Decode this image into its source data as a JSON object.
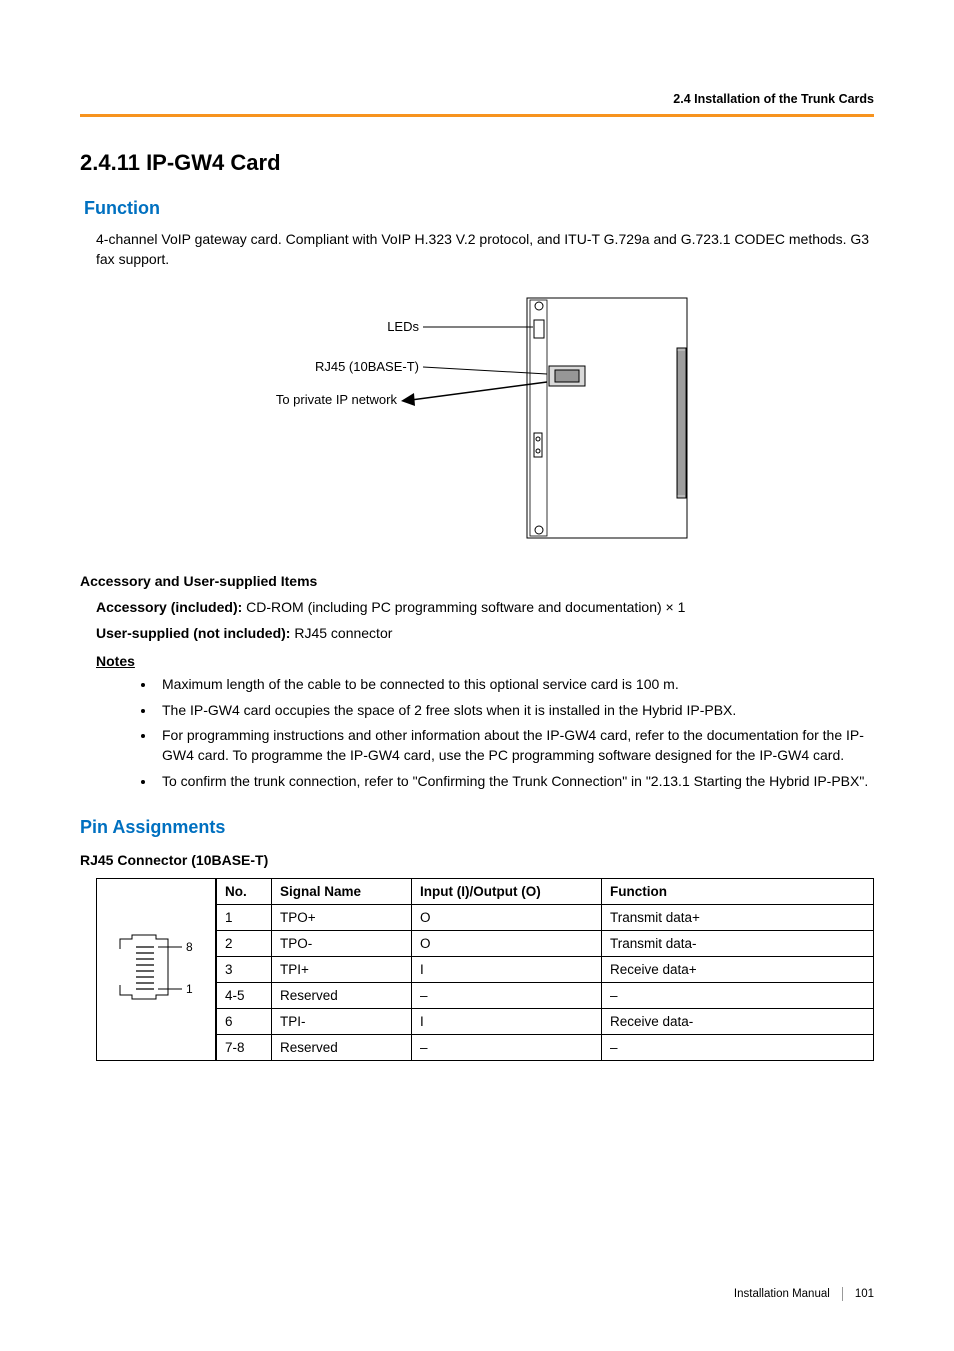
{
  "header": {
    "breadcrumb": "2.4 Installation of the Trunk Cards"
  },
  "title": "2.4.11  IP-GW4 Card",
  "function": {
    "heading": "Function",
    "body": "4-channel VoIP gateway card. Compliant with VoIP H.323 V.2 protocol, and ITU-T G.729a and G.723.1 CODEC methods. G3 fax support."
  },
  "diagram_labels": {
    "leds": "LEDs",
    "rj45": "RJ45 (10BASE-T)",
    "private_ip": "To private IP network"
  },
  "accessory_section": {
    "heading": "Accessory and User-supplied Items",
    "accessory_label": "Accessory (included):",
    "accessory_text": " CD-ROM (including PC programming software and documentation) × 1",
    "user_label": "User-supplied (not included):",
    "user_text": " RJ45 connector"
  },
  "notes": {
    "heading": "Notes",
    "items": [
      "Maximum length of the cable to be connected to this optional service card is 100 m.",
      "The IP-GW4 card occupies the space of 2 free slots when it is installed in the Hybrid IP-PBX.",
      "For programming instructions and other information about the IP-GW4 card, refer to the documentation for the IP-GW4 card. To programme the IP-GW4 card, use the PC programming software designed for the IP-GW4 card.",
      "To confirm the trunk connection, refer to \"Confirming the Trunk Connection\" in \"2.13.1 Starting the Hybrid IP-PBX\"."
    ]
  },
  "pin_section": {
    "heading": "Pin Assignments",
    "connector_heading": "RJ45 Connector (10BASE-T)",
    "columns": {
      "no": "No.",
      "signal": "Signal Name",
      "io": "Input (I)/Output (O)",
      "func": "Function"
    },
    "rows": [
      {
        "no": "1",
        "signal": "TPO+",
        "io": "O",
        "func": "Transmit data+"
      },
      {
        "no": "2",
        "signal": "TPO-",
        "io": "O",
        "func": "Transmit data-"
      },
      {
        "no": "3",
        "signal": "TPI+",
        "io": "I",
        "func": "Receive data+"
      },
      {
        "no": "4-5",
        "signal": "Reserved",
        "io": "–",
        "func": "–"
      },
      {
        "no": "6",
        "signal": "TPI-",
        "io": "I",
        "func": "Receive data-"
      },
      {
        "no": "7-8",
        "signal": "Reserved",
        "io": "–",
        "func": "–"
      }
    ],
    "rj45_labels": {
      "top": "8",
      "bottom": "1"
    }
  },
  "footer": {
    "manual": "Installation Manual",
    "page": "101"
  }
}
